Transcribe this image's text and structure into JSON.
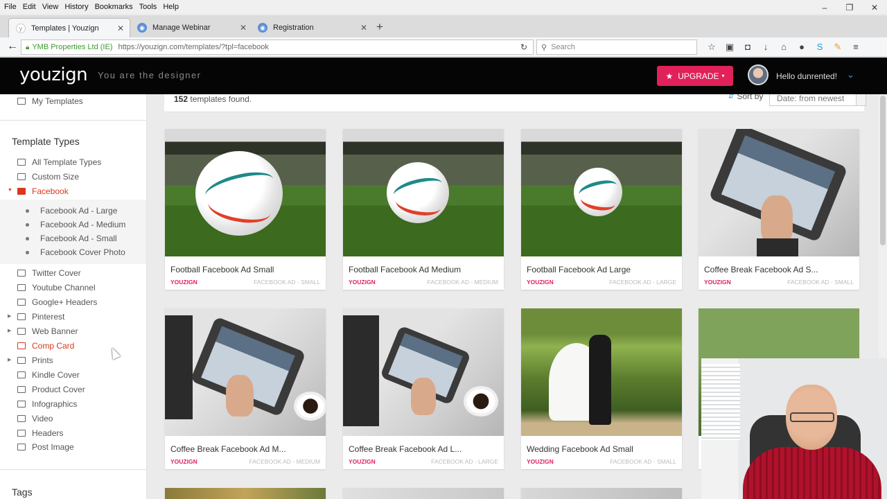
{
  "menu": [
    "File",
    "Edit",
    "View",
    "History",
    "Bookmarks",
    "Tools",
    "Help"
  ],
  "tabs": [
    {
      "label": "Templates | Youzign",
      "active": true
    },
    {
      "label": "Manage Webinar",
      "active": false
    },
    {
      "label": "Registration",
      "active": false
    }
  ],
  "address": {
    "org": "YMB Properties Ltd (IE)",
    "url": "https://youzign.com/templates/?tpl=facebook",
    "search_placeholder": "Search"
  },
  "header": {
    "logo": "youzign",
    "tagline": "You are the designer",
    "upgrade_label": "UPGRADE",
    "hello": "Hello dunrented!",
    "brand_color": "#e0215a"
  },
  "sidebar": {
    "my_templates": "My Templates",
    "heading": "Template Types",
    "items": [
      {
        "label": "All Template Types"
      },
      {
        "label": "Custom Size"
      },
      {
        "label": "Facebook",
        "active": true
      },
      {
        "label": "Twitter Cover"
      },
      {
        "label": "Youtube Channel"
      },
      {
        "label": "Google+ Headers"
      },
      {
        "label": "Pinterest"
      },
      {
        "label": "Web Banner"
      },
      {
        "label": "Comp Card"
      },
      {
        "label": "Prints"
      },
      {
        "label": "Kindle Cover"
      },
      {
        "label": "Product Cover"
      },
      {
        "label": "Infographics"
      },
      {
        "label": "Video"
      },
      {
        "label": "Headers"
      },
      {
        "label": "Post Image"
      }
    ],
    "facebook_sub": [
      "Facebook Ad - Large",
      "Facebook Ad - Medium",
      "Facebook Ad - Small",
      "Facebook Cover Photo"
    ],
    "tags_heading": "Tags"
  },
  "results": {
    "count": "152",
    "found_text": "templates found.",
    "sort_label": "Sort by",
    "sort_value": "Date: from newest"
  },
  "cards": [
    {
      "title": "Football Facebook Ad Small",
      "brand": "YOUZIGN",
      "category": "FACEBOOK AD - SMALL"
    },
    {
      "title": "Football Facebook Ad Medium",
      "brand": "YOUZIGN",
      "category": "FACEBOOK AD - MEDIUM"
    },
    {
      "title": "Football Facebook Ad Large",
      "brand": "YOUZIGN",
      "category": "FACEBOOK AD - LARGE"
    },
    {
      "title": "Coffee Break Facebook Ad S...",
      "brand": "YOUZIGN",
      "category": "FACEBOOK AD - SMALL"
    },
    {
      "title": "Coffee Break Facebook Ad M...",
      "brand": "YOUZIGN",
      "category": "FACEBOOK AD - MEDIUM"
    },
    {
      "title": "Coffee Break Facebook Ad L...",
      "brand": "YOUZIGN",
      "category": "FACEBOOK AD - LARGE"
    },
    {
      "title": "Wedding Facebook Ad Small",
      "brand": "YOUZIGN",
      "category": "FACEBOOK AD - SMALL"
    }
  ]
}
